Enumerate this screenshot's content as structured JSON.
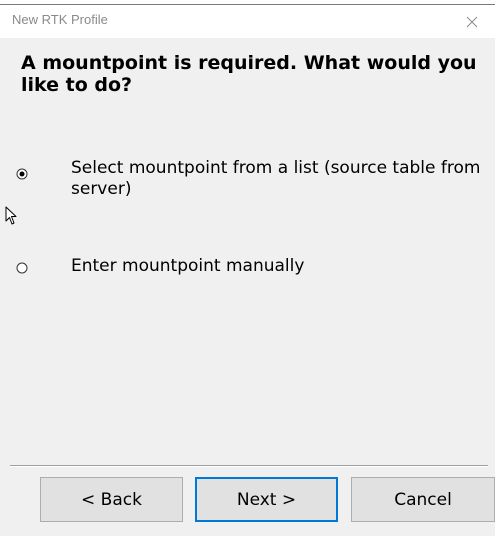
{
  "window": {
    "title": "New RTK Profile"
  },
  "question": "A mountpoint is required. What would you like to do?",
  "options": [
    {
      "label": "Select mountpoint from a list (source table from server)",
      "selected": true
    },
    {
      "label": "Enter mountpoint manually",
      "selected": false
    }
  ],
  "buttons": {
    "back": "< Back",
    "next": "Next >",
    "cancel": "Cancel"
  },
  "colors": {
    "dialog_bg": "#f0f0f0",
    "title_text": "#8a8a8a",
    "default_button_border": "#0078d7"
  },
  "icons": {
    "close": "close-icon",
    "radio": "radio-button-icon",
    "cursor": "mouse-pointer-icon"
  }
}
